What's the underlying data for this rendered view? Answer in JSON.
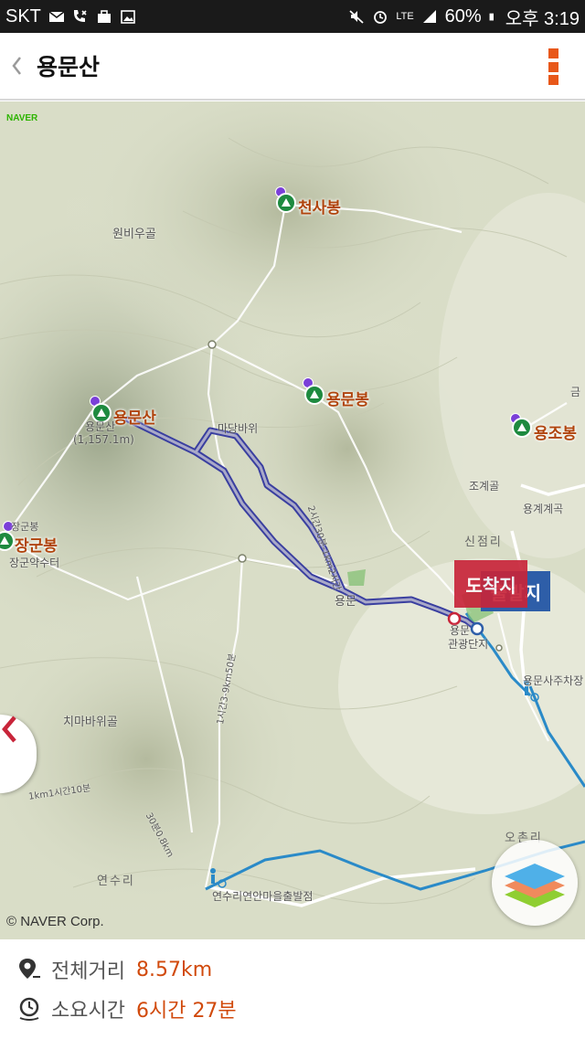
{
  "status_bar": {
    "carrier": "SKT",
    "battery": "60%",
    "time": "오후 3:19",
    "network": "LTE"
  },
  "app_bar": {
    "back_label": "《",
    "title": "용문산"
  },
  "map": {
    "provider_logo": "NAVER",
    "copyright": "© NAVER Corp.",
    "peaks": [
      {
        "name": "천사봉"
      },
      {
        "name": "용문산"
      },
      {
        "name": "용문봉"
      },
      {
        "name": "용조봉"
      },
      {
        "name": "장군봉"
      }
    ],
    "places": {
      "wonbiugol": "원비우골",
      "yongmunsan_sub": "용문산",
      "elevation": "(1,157.1m)",
      "janggunbong_small": "장군봉",
      "janggun_yaksu": "장군약수터",
      "madangbawi": "마당바위",
      "chimabawigol": "치마바위골",
      "yongmun_partial": "용문",
      "gwangwang_1": "용문",
      "gwangwang_2": "관광단지",
      "yonggye": "용계계곡",
      "jogye": "조계골",
      "parking": "용문사주차장",
      "yeonsuri_trail": "연수리연안마을출발점",
      "trail_time_1": "2시간30분-1km2시간",
      "trail_time_2": "1시간3-9km50분",
      "trail_time_3": "30분0.8km",
      "trail_time_4": "1km1시간10분",
      "geum": "금"
    },
    "towns": {
      "sinjeomri": "신점리",
      "ochonri": "오촌리",
      "yeonsuri": "연수리"
    },
    "markers": {
      "start": "출발지",
      "end": "도착지"
    }
  },
  "info": {
    "distance_label": "전체거리",
    "distance_value": "8.57km",
    "time_label": "소요시간",
    "time_value": "6시간 27분"
  },
  "colors": {
    "accent": "#e8581a",
    "route": "#3a3fa0",
    "peak_icon": "#1e8a3f",
    "end_marker": "#c8253a",
    "start_marker": "#2e5ea8",
    "stream": "#2a8ac8"
  },
  "icons": [
    "email-icon",
    "missed-call-icon",
    "briefcase-icon",
    "image-icon",
    "mute-icon",
    "alarm-icon",
    "signal-icon",
    "battery-icon",
    "back-icon",
    "more-menu-icon",
    "location-pin-icon",
    "clock-icon",
    "layers-icon",
    "chevron-left-icon"
  ]
}
